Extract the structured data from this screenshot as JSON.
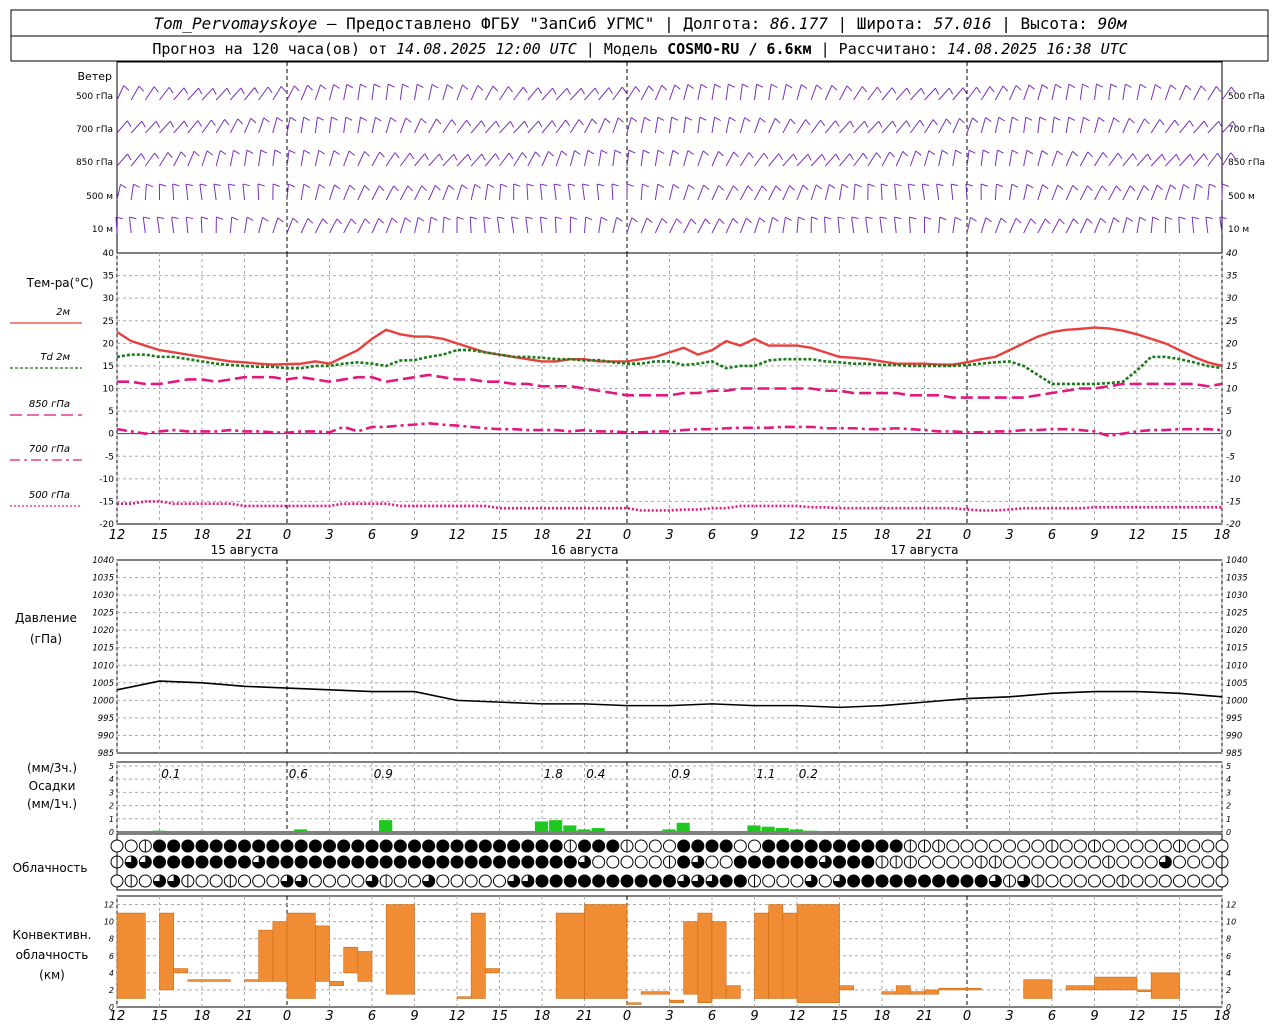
{
  "header": {
    "line1_parts": [
      "Tom_Pervomayskoye",
      " — Предоставлено ФГБУ \"ЗапСиб УГМС\" | Долгота: ",
      "86.177",
      " | Широта: ",
      "57.016",
      " | Высота: ",
      "90м"
    ],
    "line2_parts": [
      "Прогноз на 120 часа(ов) от ",
      "14.08.2025 12:00 UTC",
      "  | Модель ",
      "COSMO-RU / 6.6км",
      " | Рассчитано: ",
      "14.08.2025 16:38 UTC"
    ]
  },
  "time_axis": {
    "hour_labels": [
      "12",
      "15",
      "18",
      "21",
      "0",
      "3",
      "6",
      "9",
      "12",
      "15",
      "18",
      "21",
      "0",
      "3",
      "6",
      "9",
      "12",
      "15",
      "18",
      "21",
      "0",
      "3",
      "6",
      "9",
      "12",
      "15",
      "18"
    ],
    "day_labels": [
      {
        "text": "15 августа",
        "hour": 9
      },
      {
        "text": "16 августа",
        "hour": 33
      },
      {
        "text": "17 августа",
        "hour": 57
      }
    ],
    "midnights_hours": [
      12,
      36,
      60
    ]
  },
  "wind": {
    "title": "Ветер",
    "levels": [
      "500 гПа",
      "700 гПа",
      "850 гПа",
      "500 м",
      "10 м"
    ],
    "color": "#7b2fbe"
  },
  "temperature": {
    "title": "Тем-ра(°C)",
    "yticks": [
      40,
      35,
      30,
      25,
      20,
      15,
      10,
      5,
      0,
      -5,
      -10,
      -15,
      -20
    ],
    "legend": [
      {
        "label": "2м",
        "color": "#e8403f",
        "style": "solid"
      },
      {
        "label": "Td  2м",
        "color": "#1a7a1a",
        "style": "dotted"
      },
      {
        "label": "850 гПа",
        "color": "#e0187f",
        "style": "dashed"
      },
      {
        "label": "700 гПа",
        "color": "#e0187f",
        "style": "dashdot"
      },
      {
        "label": "500 гПа",
        "color": "#e0187f",
        "style": "dot"
      }
    ]
  },
  "pressure": {
    "title_line1": "Давление",
    "title_line2": "(гПа)",
    "yticks": [
      1040,
      1035,
      1030,
      1025,
      1020,
      1015,
      1010,
      1005,
      1000,
      995,
      990,
      985
    ]
  },
  "precip": {
    "title_line1": "(мм/3ч.)",
    "title_line2": "Осадки",
    "title_line3": "(мм/1ч.)",
    "yticks": [
      5,
      4,
      3,
      2,
      1,
      0
    ],
    "totals": [
      {
        "text": "0.1",
        "hour": 3.8
      },
      {
        "text": "0.6",
        "hour": 12.8
      },
      {
        "text": "0.9",
        "hour": 18.8
      },
      {
        "text": "1.8",
        "hour": 30.8
      },
      {
        "text": "0.4",
        "hour": 33.8
      },
      {
        "text": "0.9",
        "hour": 39.8
      },
      {
        "text": "1.1",
        "hour": 45.8
      },
      {
        "text": "0.2",
        "hour": 48.8
      }
    ]
  },
  "clouds": {
    "title": "Облачность"
  },
  "convective": {
    "title_line1": "Конвективн.",
    "title_line2": "облачность",
    "title_line3": "(км)",
    "yticks": [
      12,
      10,
      8,
      6,
      4,
      2,
      0
    ]
  },
  "chart_data": [
    {
      "type": "line",
      "title": "Тем-ра(°C)",
      "x_hours_from_start": [
        0,
        1,
        2,
        3,
        4,
        5,
        6,
        7,
        8,
        9,
        10,
        11,
        12,
        13,
        14,
        15,
        16,
        17,
        18,
        19,
        20,
        21,
        22,
        23,
        24,
        25,
        26,
        27,
        28,
        29,
        30,
        31,
        32,
        33,
        34,
        35,
        36,
        37,
        38,
        39,
        40,
        41,
        42,
        43,
        44,
        45,
        46,
        47,
        48,
        49,
        50,
        51,
        52,
        53,
        54,
        55,
        56,
        57,
        58,
        59,
        60,
        61,
        62,
        63,
        64,
        65,
        66,
        67,
        68,
        69,
        70,
        71,
        72,
        73,
        74,
        75,
        76,
        77,
        78
      ],
      "ylim": [
        -20,
        40
      ],
      "series": [
        {
          "name": "2м",
          "values": [
            22.5,
            20.5,
            19.5,
            18.5,
            18,
            17.5,
            17,
            16.5,
            16,
            15.8,
            15.5,
            15.3,
            15.4,
            15.5,
            16,
            15.5,
            17,
            18.5,
            21,
            23,
            22,
            21.5,
            21.5,
            21,
            20,
            19,
            18,
            17.5,
            17,
            16.5,
            16,
            16,
            16.5,
            16.5,
            16,
            16,
            16,
            16.5,
            17,
            18,
            19,
            17.5,
            18.5,
            20.5,
            19.5,
            21,
            19.5,
            19.5,
            19.5,
            19,
            18,
            17,
            16.8,
            16.5,
            16,
            15.5,
            15.5,
            15.5,
            15.3,
            15.3,
            15.8,
            16.5,
            17,
            18.5,
            20,
            21.5,
            22.5,
            23,
            23.2,
            23.5,
            23.3,
            22.8,
            22,
            21,
            20,
            18.5,
            17,
            15.8,
            15
          ]
        },
        {
          "name": "Td  2м",
          "values": [
            17,
            17.5,
            17.5,
            17,
            17,
            16.5,
            16,
            15.5,
            15.2,
            15,
            14.8,
            14.8,
            14.5,
            14.5,
            15,
            15,
            15.5,
            15.8,
            15.5,
            15,
            16.2,
            16.3,
            17,
            17.5,
            18.5,
            18.5,
            18,
            17.5,
            17,
            17,
            16.8,
            16.5,
            16.5,
            16.2,
            16.3,
            15.8,
            15.5,
            15.5,
            16,
            16,
            15.2,
            15.5,
            16,
            14.5,
            15,
            15,
            16.2,
            16.5,
            16.5,
            16.5,
            16,
            15.8,
            15.5,
            15.5,
            15.2,
            15.2,
            15,
            15,
            15,
            15,
            15.2,
            15.5,
            15.8,
            16,
            15,
            13,
            11,
            11,
            11,
            11,
            11.2,
            11.5,
            14,
            17,
            17,
            16.5,
            15.8,
            15,
            14.5
          ]
        },
        {
          "name": "850 гПа",
          "values": [
            11.5,
            11.5,
            11,
            11,
            11.5,
            12,
            12,
            11.5,
            12,
            12.5,
            12.5,
            12.5,
            12,
            12.5,
            12,
            11.5,
            12,
            12.5,
            12.5,
            11.5,
            12,
            12.5,
            13,
            12.5,
            12,
            12,
            11.5,
            11.5,
            11,
            11,
            10.5,
            10.5,
            10.5,
            10,
            9.5,
            9,
            8.5,
            8.5,
            8.5,
            8.5,
            9,
            9,
            9.5,
            9.5,
            10,
            10,
            10,
            10,
            10,
            10,
            9.5,
            9.5,
            9,
            9,
            9,
            9,
            8.5,
            8.5,
            8.5,
            8,
            8,
            8,
            8,
            8,
            8,
            8.5,
            9,
            9.5,
            10,
            10,
            10.5,
            11,
            11,
            11,
            11,
            11,
            11,
            10.5,
            11
          ]
        },
        {
          "name": "700 гПа",
          "values": [
            1,
            0.5,
            0,
            0.5,
            0.8,
            0.5,
            0.5,
            0.5,
            0.8,
            0.5,
            0.5,
            0.3,
            0.2,
            0.5,
            0.5,
            0.3,
            1.5,
            0.5,
            1.5,
            1.5,
            1.8,
            2,
            2.3,
            2,
            1.8,
            1.5,
            1.2,
            1,
            1,
            0.8,
            0.8,
            0.8,
            0.5,
            0.8,
            0.5,
            0.5,
            0.3,
            0.3,
            0.5,
            0.5,
            0.8,
            1,
            1,
            1.2,
            1.3,
            1.3,
            1.3,
            1.5,
            1.5,
            1.5,
            1.2,
            1.2,
            1.2,
            1,
            1,
            1.2,
            1,
            0.8,
            0.5,
            0.5,
            0.3,
            0.3,
            0.5,
            0.5,
            0.8,
            0.8,
            1,
            1,
            0.8,
            0.5,
            -0.5,
            0,
            0.5,
            0.8,
            0.8,
            1,
            1,
            1,
            0.8
          ]
        },
        {
          "name": "500 гПа",
          "values": [
            -15.5,
            -15.5,
            -15,
            -15,
            -15.5,
            -15.5,
            -15.5,
            -15.5,
            -15.5,
            -16,
            -16,
            -16,
            -16,
            -16,
            -16,
            -16,
            -15.5,
            -15.5,
            -15.5,
            -15.5,
            -16,
            -16,
            -16,
            -16,
            -16,
            -16,
            -16,
            -16.5,
            -16.5,
            -16.5,
            -16.5,
            -16.5,
            -16.5,
            -16.5,
            -16.5,
            -16.5,
            -16.5,
            -17,
            -17,
            -17,
            -16.8,
            -16.8,
            -16.5,
            -16.5,
            -16,
            -16,
            -16,
            -16,
            -16,
            -16.3,
            -16.3,
            -16.5,
            -16.5,
            -16.5,
            -16.5,
            -16.5,
            -16.5,
            -16.5,
            -16.5,
            -16.5,
            -16.8,
            -17,
            -17,
            -16.8,
            -16.5,
            -16.5,
            -16.5,
            -16.5,
            -16.5,
            -16.3,
            -16.3,
            -16.3,
            -16.3,
            -16.3,
            -16.3,
            -16.3,
            -16.3,
            -16.3,
            -16.3
          ]
        }
      ]
    },
    {
      "type": "line",
      "title": "Давление",
      "ylabel": "(гПа)",
      "x_hours_from_start": [
        0,
        3,
        6,
        9,
        12,
        15,
        18,
        21,
        24,
        27,
        30,
        33,
        36,
        39,
        42,
        45,
        48,
        51,
        54,
        57,
        60,
        63,
        66,
        69,
        72,
        75,
        78
      ],
      "ylim": [
        985,
        1040
      ],
      "series": [
        {
          "name": "",
          "values": [
            1003,
            1005.5,
            1005,
            1004,
            1003.5,
            1003,
            1002.5,
            1002.5,
            1000,
            999.5,
            999,
            999,
            998.5,
            998.5,
            999,
            998.5,
            998.5,
            998,
            998.5,
            999.5,
            1000.5,
            1001,
            1002,
            1002.5,
            1002.5,
            1002,
            1001
          ]
        }
      ]
    },
    {
      "type": "bar",
      "title": "Осадки",
      "x_hours_from_start": [
        3,
        13,
        19,
        30,
        31,
        32,
        33,
        34,
        39,
        40,
        45,
        46,
        47,
        48,
        49
      ],
      "series": [
        {
          "name": "",
          "values": [
            0.1,
            0.2,
            0.9,
            0.8,
            0.9,
            0.5,
            0.2,
            0.3,
            0.2,
            0.7,
            0.5,
            0.4,
            0.3,
            0.2,
            0.1
          ]
        }
      ]
    },
    {
      "type": "bar",
      "title": "Конвективн. облачность (км)",
      "ylim": [
        0,
        13
      ],
      "segments_hours_base_top": [
        [
          0,
          2,
          1,
          11
        ],
        [
          3,
          4,
          2,
          11
        ],
        [
          4,
          5,
          4,
          4.5
        ],
        [
          5,
          8,
          3,
          3.2
        ],
        [
          9,
          10,
          3,
          3.2
        ],
        [
          10,
          11,
          3,
          9
        ],
        [
          11,
          12,
          3,
          10
        ],
        [
          12,
          14,
          1,
          11
        ],
        [
          14,
          15,
          3,
          9.5
        ],
        [
          15,
          16,
          2.5,
          3
        ],
        [
          16,
          17,
          4,
          7
        ],
        [
          17,
          18,
          3,
          6.5
        ],
        [
          19,
          21,
          1.5,
          12
        ],
        [
          24,
          25,
          1,
          1.2
        ],
        [
          25,
          26,
          1,
          11
        ],
        [
          26,
          27,
          4,
          4.5
        ],
        [
          31,
          33,
          1,
          11
        ],
        [
          33,
          36,
          1,
          12
        ],
        [
          36,
          37,
          0.3,
          0.5
        ],
        [
          37,
          39,
          1.5,
          1.8
        ],
        [
          39,
          40,
          0.5,
          0.8
        ],
        [
          40,
          41,
          1.5,
          10
        ],
        [
          41,
          42,
          0.5,
          11
        ],
        [
          42,
          43,
          1,
          10
        ],
        [
          43,
          44,
          1,
          2.5
        ],
        [
          45,
          46,
          1,
          11
        ],
        [
          46,
          47,
          1,
          12
        ],
        [
          47,
          48,
          1,
          11
        ],
        [
          48,
          51,
          0.5,
          12
        ],
        [
          51,
          52,
          2,
          2.5
        ],
        [
          54,
          55,
          1.5,
          1.8
        ],
        [
          55,
          56,
          1.5,
          2.5
        ],
        [
          56,
          57,
          1.5,
          1.8
        ],
        [
          57,
          58,
          1.5,
          2
        ],
        [
          58,
          61,
          2,
          2.2
        ],
        [
          64,
          66,
          1,
          3.2
        ],
        [
          67,
          69,
          2,
          2.5
        ],
        [
          69,
          72,
          2,
          3.5
        ],
        [
          72,
          73,
          1.8,
          2
        ],
        [
          73,
          75,
          1,
          4
        ]
      ]
    }
  ]
}
